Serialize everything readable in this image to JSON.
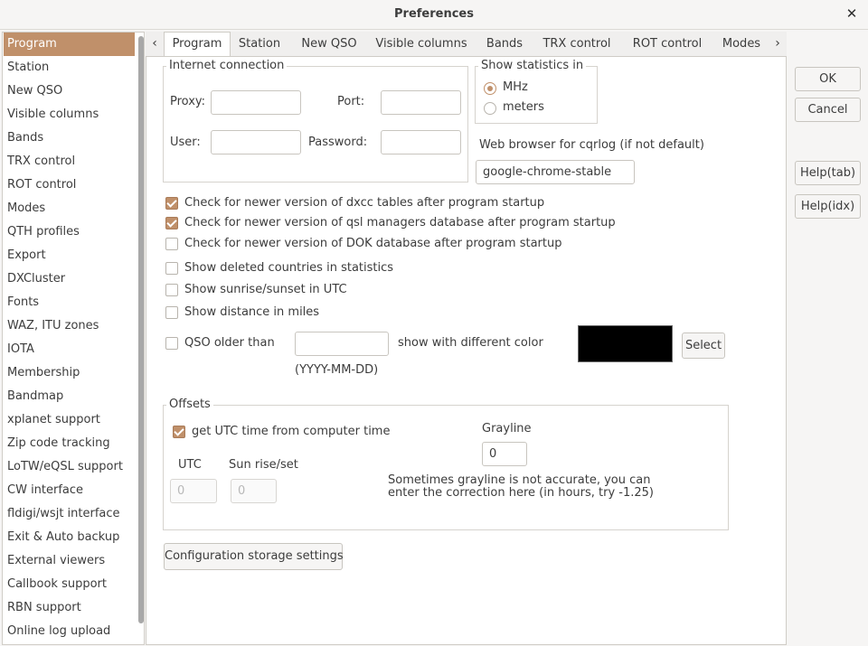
{
  "window": {
    "title": "Preferences"
  },
  "sidebar": {
    "items": [
      {
        "label": "Program"
      },
      {
        "label": "Station"
      },
      {
        "label": "New QSO"
      },
      {
        "label": "Visible columns"
      },
      {
        "label": "Bands"
      },
      {
        "label": "TRX control"
      },
      {
        "label": "ROT control"
      },
      {
        "label": "Modes"
      },
      {
        "label": "QTH profiles"
      },
      {
        "label": "Export"
      },
      {
        "label": "DXCluster"
      },
      {
        "label": "Fonts"
      },
      {
        "label": "WAZ, ITU zones"
      },
      {
        "label": "IOTA"
      },
      {
        "label": "Membership"
      },
      {
        "label": "Bandmap"
      },
      {
        "label": "xplanet support"
      },
      {
        "label": "Zip code tracking"
      },
      {
        "label": "LoTW/eQSL support"
      },
      {
        "label": "CW interface"
      },
      {
        "label": "fldigi/wsjt interface"
      },
      {
        "label": "Exit & Auto backup"
      },
      {
        "label": "External viewers"
      },
      {
        "label": "Callbook support"
      },
      {
        "label": "RBN support"
      },
      {
        "label": "Online log upload"
      }
    ],
    "selected": "Program"
  },
  "tabs": [
    {
      "label": "Program"
    },
    {
      "label": "Station"
    },
    {
      "label": "New QSO"
    },
    {
      "label": "Visible columns"
    },
    {
      "label": "Bands"
    },
    {
      "label": "TRX control"
    },
    {
      "label": "ROT control"
    },
    {
      "label": "Modes"
    }
  ],
  "active_tab": "Program",
  "internet": {
    "title": "Internet connection",
    "proxy_label": "Proxy:",
    "proxy_value": "",
    "port_label": "Port:",
    "port_value": "",
    "user_label": "User:",
    "user_value": "",
    "password_label": "Password:",
    "password_value": ""
  },
  "stats": {
    "title": "Show statistics in",
    "options": [
      {
        "label": "MHz",
        "selected": true
      },
      {
        "label": "meters",
        "selected": false
      }
    ]
  },
  "browser": {
    "label": "Web browser for cqrlog (if not default)",
    "value": "google-chrome-stable"
  },
  "checks": [
    {
      "label": "Check for newer version of dxcc tables after program startup",
      "checked": true
    },
    {
      "label": "Check for newer version of qsl managers database  after program startup",
      "checked": true
    },
    {
      "label": "Check for newer version of DOK database  after program startup",
      "checked": false
    },
    {
      "label": "Show deleted countries in statistics",
      "checked": false
    },
    {
      "label": "Show sunrise/sunset in UTC",
      "checked": false
    },
    {
      "label": "Show distance in miles",
      "checked": false
    }
  ],
  "qso_older": {
    "label": "QSO older than",
    "checked": false,
    "value": "",
    "format_hint": "(YYYY-MM-DD)",
    "suffix": "show with different color",
    "color": "#000000",
    "select_label": "Select"
  },
  "offsets": {
    "title": "Offsets",
    "utc_check_label": "get UTC time from computer time",
    "utc_checked": true,
    "utc_label": "UTC",
    "utc_value": "0",
    "sun_label": "Sun rise/set",
    "sun_value": "0",
    "grayline_label": "Grayline",
    "grayline_value": "0",
    "note_line1": "Sometimes grayline is not accurate, you can",
    "note_line2": "enter the correction here (in hours, try -1.25)"
  },
  "config_button": "Configuration storage settings",
  "buttons": {
    "ok": "OK",
    "cancel": "Cancel",
    "help_tab": "Help(tab)",
    "help_idx": "Help(idx)"
  },
  "colors": {
    "accent": "#c0906a",
    "background": "#f6f5f4"
  }
}
